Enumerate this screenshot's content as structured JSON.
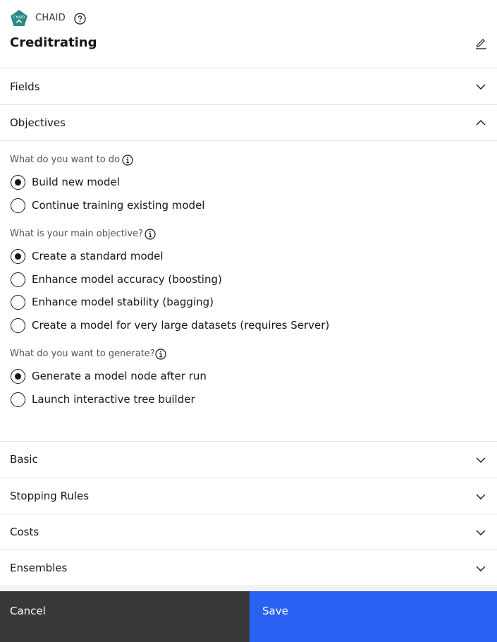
{
  "header": {
    "node_icon_label": "CHAID",
    "node_type": "CHAID",
    "title": "Creditrating",
    "icons": {
      "node": "chaid-node-icon",
      "help": "help-icon",
      "edit": "edit-pencil-icon"
    }
  },
  "sections_top": [
    {
      "label": "Fields",
      "expanded": false
    },
    {
      "label": "Objectives",
      "expanded": true
    }
  ],
  "objectives": {
    "q1": {
      "label": "What do you want to do",
      "options": [
        {
          "label": "Build new model",
          "checked": true
        },
        {
          "label": "Continue training existing model",
          "checked": false
        }
      ]
    },
    "q2": {
      "label": "What is your main objective?",
      "options": [
        {
          "label": "Create a standard model",
          "checked": true
        },
        {
          "label": "Enhance model accuracy (boosting)",
          "checked": false
        },
        {
          "label": "Enhance model stability (bagging)",
          "checked": false
        },
        {
          "label": "Create a model for very large datasets (requires Server)",
          "checked": false
        }
      ]
    },
    "q3": {
      "label": "What do you want to generate?",
      "options": [
        {
          "label": "Generate a model node after run",
          "checked": true
        },
        {
          "label": "Launch interactive tree builder",
          "checked": false
        }
      ]
    }
  },
  "sections_bottom": [
    {
      "label": "Basic",
      "expanded": false
    },
    {
      "label": "Stopping Rules",
      "expanded": false
    },
    {
      "label": "Costs",
      "expanded": false
    },
    {
      "label": "Ensembles",
      "expanded": false
    }
  ],
  "footer": {
    "cancel_label": "Cancel",
    "save_label": "Save"
  },
  "colors": {
    "node_icon": "#2b8a88",
    "save_button": "#2962f2",
    "cancel_button": "#393939"
  }
}
